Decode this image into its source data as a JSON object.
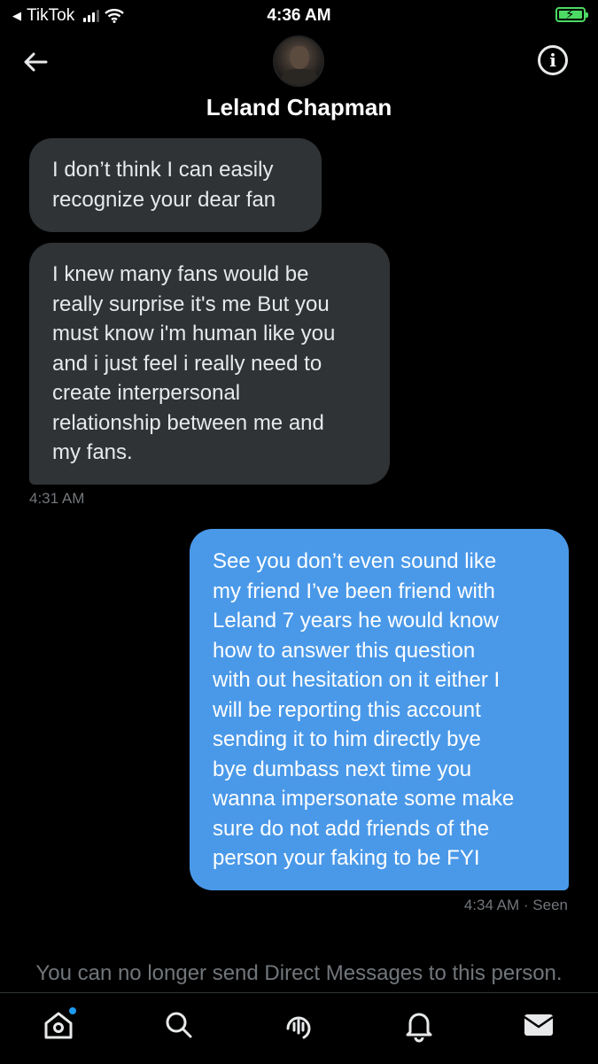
{
  "status_bar": {
    "back_app": "TikTok",
    "time": "4:36 AM"
  },
  "header": {
    "contact_name": "Leland Chapman",
    "back_icon": "arrow-left-icon",
    "info_icon": "info-icon",
    "info_glyph": "i"
  },
  "messages": [
    {
      "direction": "in",
      "text": "I don’t think I can easily\nrecognize your dear fan"
    },
    {
      "direction": "in",
      "text": "I knew many fans would be\nreally surprise it's me But you\nmust know i'm human like you\nand i just feel i really need to\ncreate interpersonal\nrelationship between me and\nmy fans."
    },
    {
      "direction": "out",
      "text": "See you don’t even sound like\nmy friend I’ve been friend with\nLeland 7 years he would know\nhow to answer this question\nwith out hesitation on it either I\nwill be reporting this account\nsending it to him directly bye\nbye dumbass next time you\nwanna impersonate some make\nsure do not add friends of the\nperson your faking to be FYI"
    }
  ],
  "timestamps": {
    "incoming": "4:31 AM",
    "outgoing": "4:34 AM · Seen"
  },
  "notice": "You can no longer send Direct Messages to this person.",
  "tabbar": {
    "items": [
      "home-icon",
      "search-icon",
      "spaces-icon",
      "notifications-icon",
      "messages-icon"
    ],
    "accent": "#1d9bf0"
  },
  "colors": {
    "incoming_bubble": "#2f3336",
    "outgoing_bubble": "#4a99e9",
    "battery": "#4cd964"
  }
}
